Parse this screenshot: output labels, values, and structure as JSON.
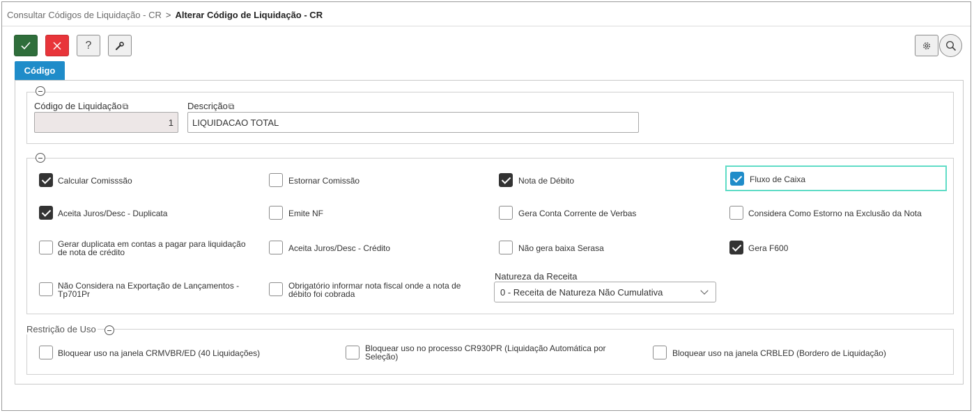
{
  "breadcrumb": {
    "parent": "Consultar Códigos de Liquidação - CR",
    "separator": ">",
    "current": "Alterar Código de Liquidação - CR"
  },
  "toolbar": {
    "confirm_icon": "check-icon",
    "cancel_icon": "close-icon",
    "help_label": "?",
    "tools_icon": "wrench-icon",
    "settings_icon": "gear-icon",
    "search_icon": "search-icon"
  },
  "tabs": [
    {
      "label": "Código",
      "active": true
    }
  ],
  "codigo_section": {
    "codigo_label": "Código de Liquidação",
    "codigo_value": "1",
    "descricao_label": "Descrição",
    "descricao_value": "LIQUIDACAO TOTAL"
  },
  "options": [
    {
      "label": "Calcular Comisssão",
      "checked": true
    },
    {
      "label": "Estornar Comissão",
      "checked": false
    },
    {
      "label": "Nota de Débito",
      "checked": true
    },
    {
      "label": "Fluxo de Caixa",
      "checked": true,
      "focused": true
    },
    {
      "label": "Aceita Juros/Desc - Duplicata",
      "checked": true
    },
    {
      "label": "Emite NF",
      "checked": false
    },
    {
      "label": "Gera Conta Corrente de Verbas",
      "checked": false
    },
    {
      "label": "Considera Como Estorno na Exclusão da Nota",
      "checked": false
    },
    {
      "label_line1": "Gerar duplicata em contas a pagar para liquidação",
      "label_line2": "de nota de crédito",
      "checked": false
    },
    {
      "label": "Aceita Juros/Desc - Crédito",
      "checked": false
    },
    {
      "label": "Não gera baixa Serasa",
      "checked": false
    },
    {
      "label": "Gera F600",
      "checked": true
    },
    {
      "label_line1": "Não Considera na Exportação de Lançamentos -",
      "label_line2": "Tp701Pr",
      "checked": false
    },
    {
      "label_line1": "Obrigatório informar nota fiscal onde a nota de",
      "label_line2": "débito foi cobrada",
      "checked": false
    }
  ],
  "natureza": {
    "label": "Natureza da Receita",
    "selected": "0 - Receita de Natureza Não Cumulativa"
  },
  "restricao": {
    "legend": "Restrição de Uso",
    "items": [
      {
        "label": "Bloquear uso na janela CRMVBR/ED (40 Liquidações)",
        "checked": false
      },
      {
        "label_line1": "Bloquear uso no processo CR930PR (Liquidação Automática por",
        "label_line2": "Seleção)",
        "checked": false
      },
      {
        "label": "Bloquear uso na janela CRBLED (Bordero de Liquidação)",
        "checked": false
      }
    ]
  },
  "colors": {
    "confirm": "#2f6e3b",
    "cancel": "#e8353a",
    "accent": "#1f8cc9",
    "focus": "#5fdcc6"
  }
}
